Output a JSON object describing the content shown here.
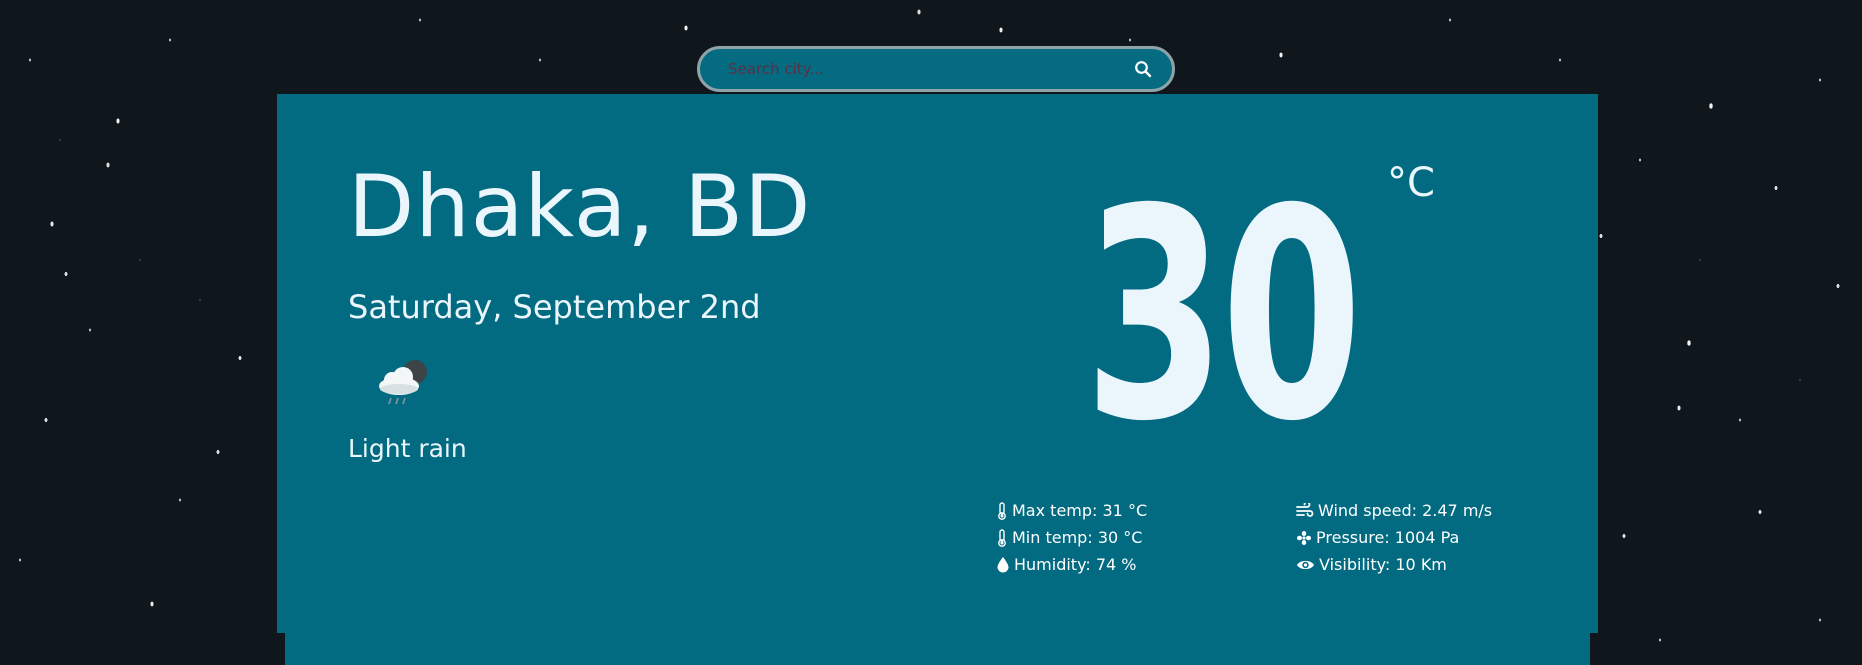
{
  "search": {
    "placeholder": "Search city..."
  },
  "location": {
    "city_label": "Dhaka, BD"
  },
  "date_label": "Saturday, September 2nd",
  "condition": {
    "icon": "cloud-rain-night-icon",
    "label": "Light rain"
  },
  "temperature": {
    "value": "30",
    "unit": "°C"
  },
  "details": {
    "max_temp": "Max temp: 31 °C",
    "min_temp": "Min temp: 30 °C",
    "humidity": "Humidity: 74 %",
    "wind_speed": "Wind speed: 2.47 m/s",
    "pressure": "Pressure: 1004 Pa",
    "visibility": "Visibility: 10 Km"
  },
  "colors": {
    "card_background": "#026b82",
    "page_background": "#0f171c",
    "text": "#eaf6fb",
    "search_border": "#8ea4a8",
    "placeholder": "#5d2f45"
  }
}
